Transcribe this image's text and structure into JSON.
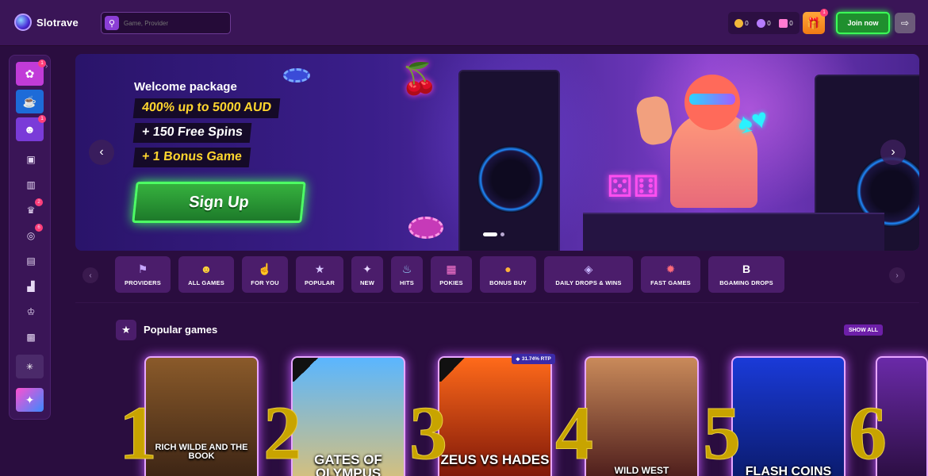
{
  "header": {
    "brand": "Slotrave",
    "search_placeholder": "Game, Provider",
    "balances": [
      {
        "icon": "gold-coin-icon",
        "value": "0",
        "color": "#f3b83a"
      },
      {
        "icon": "purple-coin-icon",
        "value": "0",
        "color": "#b67cff"
      },
      {
        "icon": "bb-icon",
        "value": "0",
        "color": "#ff7ad1"
      }
    ],
    "gift_badge": "1",
    "join_label": "Join now"
  },
  "sidebar": {
    "tiles": [
      {
        "name": "sidebar-promo-wheel",
        "badge": "1",
        "color": "#c13bd8"
      },
      {
        "name": "sidebar-promo-cocktail",
        "badge": "",
        "color": "#1d6bd8"
      },
      {
        "name": "sidebar-promo-character",
        "badge": "1",
        "color": "#7a3bd8"
      }
    ],
    "icons": [
      {
        "name": "cashier-icon",
        "glyph": "▣",
        "badge": ""
      },
      {
        "name": "gift-box-icon",
        "glyph": "▥",
        "badge": ""
      },
      {
        "name": "trophy-icon",
        "glyph": "♛",
        "badge": "2"
      },
      {
        "name": "medal-icon",
        "glyph": "◎",
        "badge": "6"
      },
      {
        "name": "cards-icon",
        "glyph": "▤",
        "badge": ""
      },
      {
        "name": "leaderboard-icon",
        "glyph": "▟",
        "badge": ""
      },
      {
        "name": "crown-icon",
        "glyph": "♔",
        "badge": ""
      },
      {
        "name": "chat-icon",
        "glyph": "▩",
        "badge": ""
      }
    ]
  },
  "banner": {
    "title": "Welcome package",
    "line1": "400% up to 5000 AUD",
    "line2": "+ 150 Free Spins",
    "line3": "+ 1 Bonus Game",
    "cta": "Sign Up"
  },
  "categories": [
    {
      "label": "PROVIDERS",
      "icon": "⚑",
      "color": "#c7a6ff"
    },
    {
      "label": "ALL GAMES",
      "icon": "☻",
      "color": "#ffd43a"
    },
    {
      "label": "FOR YOU",
      "icon": "☝",
      "color": "#ff9a6a"
    },
    {
      "label": "POPULAR",
      "icon": "★",
      "color": "#d7c6ff"
    },
    {
      "label": "NEW",
      "icon": "✦",
      "color": "#e6d6ff"
    },
    {
      "label": "HITS",
      "icon": "♨",
      "color": "#9ad6ff"
    },
    {
      "label": "POKIES",
      "icon": "▦",
      "color": "#ff7ad1"
    },
    {
      "label": "BONUS BUY",
      "icon": "●",
      "color": "#ffb23a"
    },
    {
      "label": "DAILY DROPS & WINS",
      "icon": "◈",
      "color": "#c9b6ff"
    },
    {
      "label": "FAST GAMES",
      "icon": "✹",
      "color": "#ff6a7a"
    },
    {
      "label": "BGAMING DROPS",
      "icon": "B",
      "color": "#ffffff"
    }
  ],
  "popular": {
    "title": "Popular games",
    "show_all": "SHOW ALL",
    "rtp": "31.74% RTP",
    "games": [
      {
        "rank": "1",
        "title": "RICH WILDE AND THE BOOK",
        "colors": [
          "#8a5a2a",
          "#3a2314"
        ]
      },
      {
        "rank": "2",
        "title": "GATES OF OLYMPUS",
        "colors": [
          "#5ab6ff",
          "#d8c07a"
        ]
      },
      {
        "rank": "3",
        "title": "ZEUS VS HADES",
        "colors": [
          "#ff6a1a",
          "#7a1408"
        ]
      },
      {
        "rank": "4",
        "title": "WILD WEST",
        "colors": [
          "#c98a5a",
          "#4a1a1a"
        ]
      },
      {
        "rank": "5",
        "title": "FLASH COINS",
        "colors": [
          "#1a3ad8",
          "#0a1a6a"
        ]
      },
      {
        "rank": "6",
        "title": "",
        "colors": [
          "#6a2aa8",
          "#2a0d3f"
        ]
      }
    ]
  }
}
